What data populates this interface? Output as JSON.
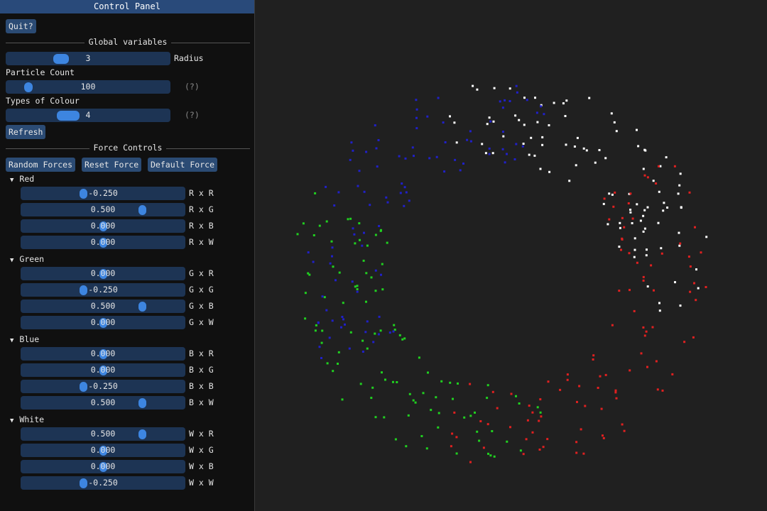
{
  "window_title": "Control Panel",
  "quit_label": "Quit?",
  "global_header": "Global variables",
  "radius": {
    "value": "3",
    "label": "Radius",
    "fraction": 0.32
  },
  "particle_count": {
    "title": "Particle Count",
    "value": "100",
    "help": "(?)",
    "fraction": 0.12
  },
  "colour_types": {
    "title": "Types of Colour",
    "value": "4",
    "help": "(?)",
    "fraction": 0.36
  },
  "refresh_label": "Refresh",
  "force_header": "Force Controls",
  "force_buttons": {
    "random": "Random Forces",
    "reset": "Reset Force",
    "default": "Default Force"
  },
  "groups": [
    {
      "name": "Red",
      "rows": [
        {
          "value": "-0.250",
          "label": "R x R",
          "num": -0.25
        },
        {
          "value": "0.500",
          "label": "R x G",
          "num": 0.5
        },
        {
          "value": "0.000",
          "label": "R x B",
          "num": 0
        },
        {
          "value": "0.000",
          "label": "R x W",
          "num": 0
        }
      ]
    },
    {
      "name": "Green",
      "rows": [
        {
          "value": "0.000",
          "label": "G x R",
          "num": 0
        },
        {
          "value": "-0.250",
          "label": "G x G",
          "num": -0.25
        },
        {
          "value": "0.500",
          "label": "G x B",
          "num": 0.5
        },
        {
          "value": "0.000",
          "label": "G x W",
          "num": 0
        }
      ]
    },
    {
      "name": "Blue",
      "rows": [
        {
          "value": "0.000",
          "label": "B x R",
          "num": 0
        },
        {
          "value": "0.000",
          "label": "B x G",
          "num": 0
        },
        {
          "value": "-0.250",
          "label": "B x B",
          "num": -0.25
        },
        {
          "value": "0.500",
          "label": "B x W",
          "num": 0.5
        }
      ]
    },
    {
      "name": "White",
      "rows": [
        {
          "value": "0.500",
          "label": "W x R",
          "num": 0.5
        },
        {
          "value": "0.000",
          "label": "W x G",
          "num": 0
        },
        {
          "value": "0.000",
          "label": "W x B",
          "num": 0
        },
        {
          "value": "-0.250",
          "label": "W x W",
          "num": -0.25
        }
      ]
    }
  ],
  "colors": {
    "red": "#e02020",
    "green": "#20d020",
    "blue": "#2020c8",
    "white": "#ffffff"
  }
}
